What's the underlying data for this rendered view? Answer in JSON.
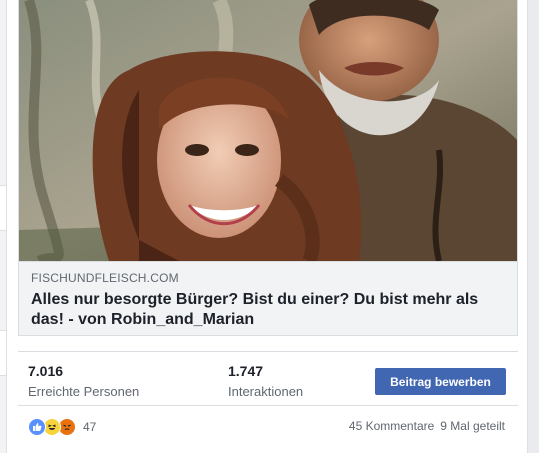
{
  "link_preview": {
    "domain": "FISCHUNDFLEISCH.COM",
    "headline": "Alles nur besorgte Bürger? Bist du einer? Du bist mehr als das! - von Robin_and_Marian"
  },
  "insights": {
    "reached": {
      "value": "7.016",
      "label": "Erreichte Personen"
    },
    "interactions": {
      "value": "1.747",
      "label": "Interaktionen"
    },
    "boost_label": "Beitrag bewerben"
  },
  "engagement": {
    "reaction_icons": [
      "like-icon",
      "haha-icon",
      "angry-icon"
    ],
    "reaction_count": "47",
    "comments": "45 Kommentare",
    "shares": "9 Mal geteilt"
  },
  "colors": {
    "accent": "#4267b2",
    "text": "#1d2129",
    "secondary_text": "#606770",
    "page_bg": "#e9ebee"
  }
}
